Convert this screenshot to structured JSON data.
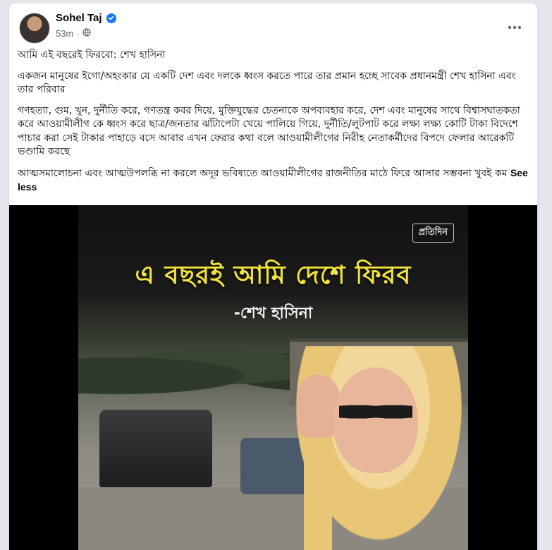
{
  "post": {
    "author": "Sohel Taj",
    "timestamp": "53m",
    "privacy_icon": "globe-icon",
    "verified_icon": "verified-badge-icon",
    "paragraphs": [
      "আমি এই বছরেই ফিরবো: শেখ হাসিনা",
      "একজন মানুষের ইগো/অহংকার যে একটি দেশ এবং দলকে ধ্বংস করতে পারে তার প্রমান হচ্ছে সাবেক প্রধানমন্ত্রী শেখ হাসিনা এবং তার পরিবার",
      "গণহত্যা, গুম, খুন, দুর্নীতি করে, গণতন্ত্র কবর দিয়ে, মুক্তিযুদ্ধের চেতনাকে অপব্যবহার করে, দেশ এবং মানুষের সাথে বিশ্বাসঘাতকতা করে আওয়ামীলীগ কে ধ্বংস করে ছাত্র/জনতার ঝাঁটাপেটা খেয়ে পালিয়ে গিয়ে, দুর্নীতি/লুটপাট করে লক্ষ্য লক্ষ্য কোটি টাকা বিদেশে পাচার করা সেই টাকার পাহাড়ে বসে আবার এখন ফেরার কথা বলে আওয়ামীলীগের নিরীহ নেতাকর্মীদের বিপদে ফেলার আরেকটি ভণ্ডামি করছে"
    ],
    "last_paragraph": "আত্মসমালোচনা এবং আত্মউপলব্ধি না করলে অদূর ভবিষ্যতে আওয়ামীলীগের রাজনীতির মাঠে ফিরে আসার সম্ভবনা খুবই কম",
    "see_less": "See less"
  },
  "image": {
    "brand": "প্রতিদিন",
    "headline": "এ বছরই আমি দেশে ফিরব",
    "byline": "-শেখ হাসিনা"
  },
  "colors": {
    "accent": "#1877f2",
    "headline": "#f2e43c",
    "muted": "#65676b"
  }
}
